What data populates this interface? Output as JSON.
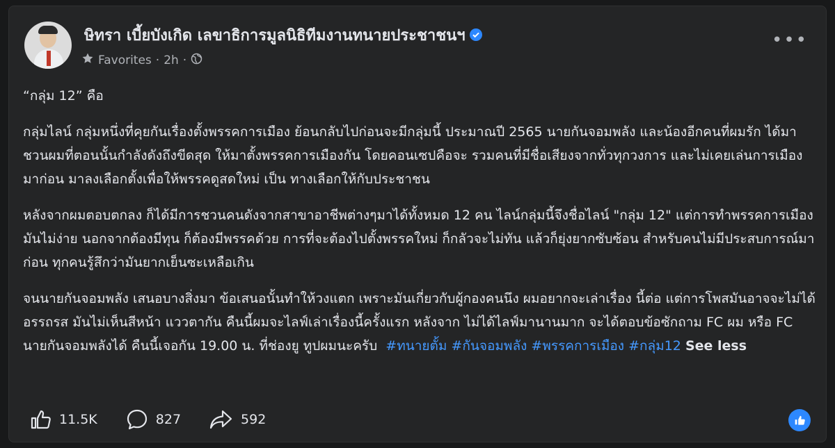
{
  "post": {
    "author": "ษิทรา เบี้ยบังเกิด เลขาธิการมูลนิธิทีมงานทนายประชาชนฯ",
    "meta": {
      "audience": "Favorites",
      "separator": "·",
      "time": "2h"
    },
    "paragraphs": [
      "“กลุ่ม 12” คือ",
      "กลุ่มไลน์ กลุ่มหนึ่งที่คุยกันเรื่องตั้งพรรคการเมือง ย้อนกลับไปก่อนจะมีกลุ่มนี้ ประมาณปี 2565 นายกันจอมพลัง และน้องอีกคนที่ผมรัก ได้มาชวนผมที่ตอนนั้นกำลังดังถึงขีดสุด ให้มาตั้งพรรคการเมืองกัน โดยคอนเซปคือจะ รวมคนที่มีชื่อเสียงจากทั่วทุกวงการ และไม่เคยเล่นการเมืองมาก่อน มาลงเลือกตั้งเพื่อให้พรรคดูสดใหม่  เป็น ทางเลือกให้กับประชาชน",
      "หลังจากผมตอบตกลง ก็ได้มีการชวนคนดังจากสาขาอาชีพต่างๆมาได้ทั้งหมด 12 คน ไลน์กลุ่มนี้จึงชื่อไลน์ \"กลุ่ม 12\" แต่การทำพรรคการเมืองมันไม่ง่าย นอกจากต้องมีทุน ก็ต้องมีพรรคด้วย การที่จะต้องไปตั้งพรรคใหม่ ก็กลัวจะไม่ทัน แล้วก็ยุ่งยากซับซ้อน สำหรับคนไม่มีประสบการณ์มาก่อน ทุกคนรู้สึกว่ามันยากเย็นซะเหลือเกิน"
    ],
    "last_paragraph": "จนนายกันจอมพลัง เสนอบางสิ่งมา ข้อเสนอนั้นทำให้วงแตก เพราะมันเกี่ยวกับผู้กองคนนึง ผมอยากจะเล่าเรื่อง นี้ต่อ แต่การโพสมันอาจจะไม่ได้อรรถรส มันไม่เห็นสีหน้า แววตากัน คืนนี้ผมจะไลฟ์เล่าเรื่องนี้ครั้งแรก หลังจาก ไม่ได้ไลฟ์มานานมาก จะได้ตอบข้อซักถาม FC ผม หรือ FC นายกันจอมพลังได้ คืนนี้เจอกัน 19.00 น. ที่ช่องยู ทูปผมนะครับ",
    "hashtags": [
      "#ทนายตั้ม",
      "#กันจอมพลัง",
      "#พรรคการเมือง",
      "#กลุ่ม12"
    ],
    "see_less": "See less"
  },
  "stats": {
    "likes": "11.5K",
    "comments": "827",
    "shares": "592"
  },
  "colors": {
    "background": "#18191a",
    "card": "#242526",
    "text": "#e4e6eb",
    "secondary": "#b0b3b8",
    "link": "#4599ff",
    "accent": "#2d88ff"
  },
  "icons": {
    "verified": "verified-badge-icon",
    "favorites": "star-icon",
    "audience": "globe-icon",
    "more": "more-horizontal-icon",
    "like": "thumbs-up-icon",
    "comment": "comment-bubble-icon",
    "share": "share-arrow-icon",
    "reaction": "like-reaction-icon"
  }
}
